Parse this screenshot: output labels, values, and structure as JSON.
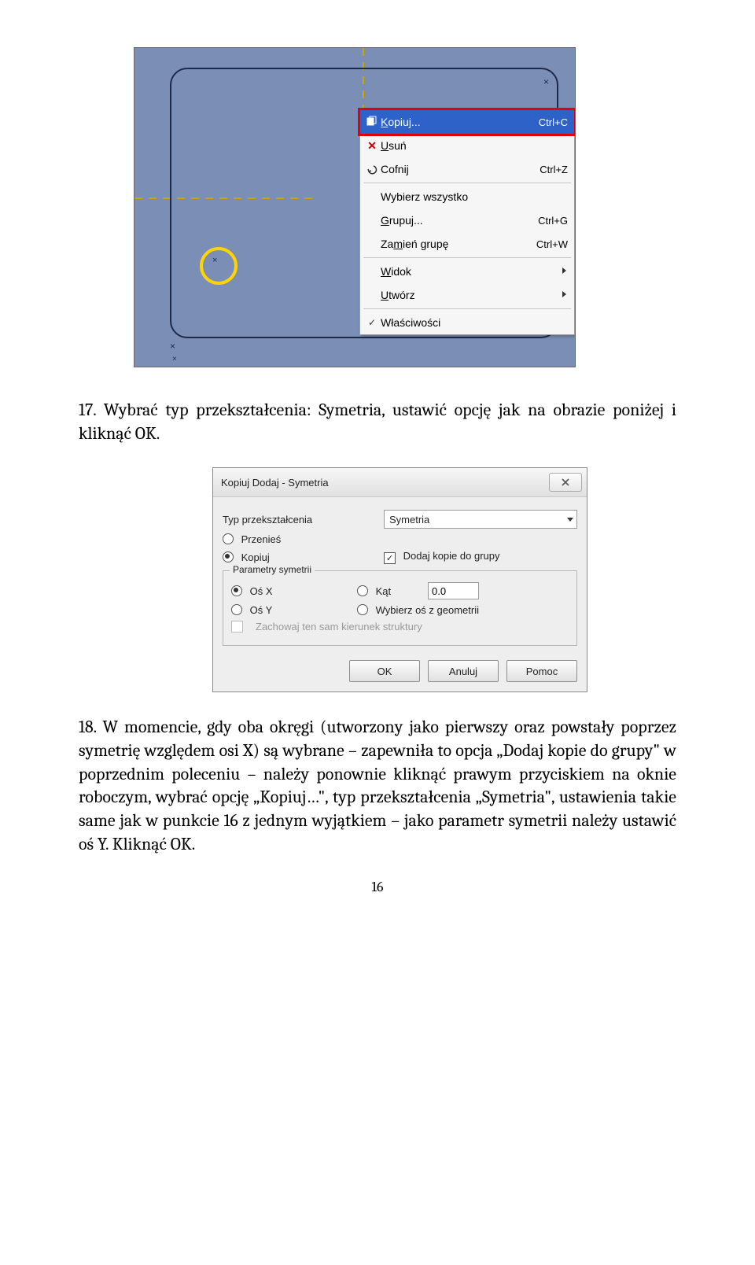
{
  "step17_text": "17. Wybrać typ przekształcenia: Symetria, ustawić opcję jak na obrazie poniżej i kliknąć OK.",
  "step18_text": "18. W momencie, gdy oba okręgi (utworzony jako pierwszy oraz powstały poprzez symetrię względem osi X) są wybrane – zapewniła to opcja „Dodaj kopie do grupy\" w poprzednim poleceniu – należy ponownie kliknąć prawym przyciskiem na oknie roboczym, wybrać opcję „Kopiuj…\", typ przekształcenia „Symetria\", ustawienia takie same jak w punkcie 16 z jednym wyjątkiem – jako parametr symetrii należy ustawić oś Y. Kliknąć OK.",
  "page_number": "16",
  "context_menu": {
    "kopiuj": {
      "label": "Kopiuj...",
      "u": "K",
      "shortcut": "Ctrl+C"
    },
    "usun": {
      "label": "Usuń",
      "u": "U"
    },
    "cofnij": {
      "label": "Cofnij",
      "shortcut": "Ctrl+Z"
    },
    "wybierz": {
      "label": "Wybierz wszystko"
    },
    "grupuj": {
      "label": "Grupuj...",
      "u": "G",
      "shortcut": "Ctrl+G"
    },
    "zamien": {
      "label": "Zamień grupę",
      "u": "m",
      "shortcut": "Ctrl+W"
    },
    "widok": {
      "label": "Widok",
      "u": "W"
    },
    "utworz": {
      "label": "Utwórz",
      "u": "U"
    },
    "wlasciwosci": {
      "label": "Właściwości"
    }
  },
  "dialog": {
    "title": "Kopiuj Dodaj - Symetria",
    "type_label": "Typ przekształcenia",
    "type_value": "Symetria",
    "radio_przenies": "Przenieś",
    "radio_kopiuj": "Kopiuj",
    "cb_dodaj": "Dodaj kopie do grupy",
    "fieldset_title": "Parametry symetrii",
    "osx": "Oś X",
    "osy": "Oś Y",
    "kat": "Kąt",
    "kat_value": "0.0",
    "wybierz_os": "Wybierz oś z geometrii",
    "zachowaj": "Zachowaj ten sam kierunek struktury",
    "btn_ok": "OK",
    "btn_anuluj": "Anuluj",
    "btn_pomoc": "Pomoc"
  }
}
